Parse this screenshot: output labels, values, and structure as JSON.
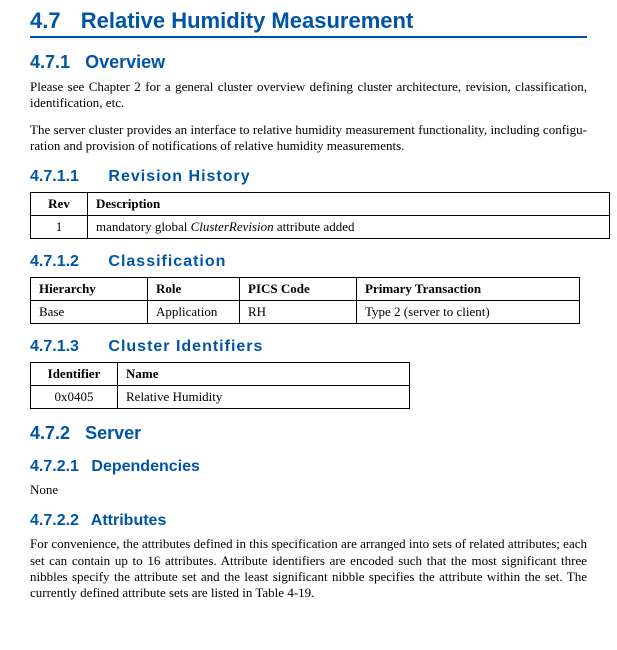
{
  "section": {
    "number": "4.7",
    "title": "Relative Humidity Measurement"
  },
  "overview": {
    "number": "4.7.1",
    "title": "Overview",
    "para1": "Please see Chapter 2 for a general cluster overview defining cluster architecture, revision, classification, identification, etc.",
    "para2": "The server cluster provides an interface to relative humidity measurement functionality, including configu­ration and provision of notifications of relative humidity measurements."
  },
  "revision_history": {
    "number": "4.7.1.1",
    "title": "Revision History",
    "headers": {
      "rev": "Rev",
      "desc": "Description"
    },
    "rows": [
      {
        "rev": "1",
        "desc_prefix": "mandatory global ",
        "desc_italic": "ClusterRevision",
        "desc_suffix": " attribute added"
      }
    ]
  },
  "classification": {
    "number": "4.7.1.2",
    "title": "Classification",
    "headers": {
      "hierarchy": "Hierarchy",
      "role": "Role",
      "pics": "PICS Code",
      "primary": "Primary Transaction"
    },
    "rows": [
      {
        "hierarchy": "Base",
        "role": "Application",
        "pics": "RH",
        "primary": "Type 2 (server to client)"
      }
    ]
  },
  "cluster_identifiers": {
    "number": "4.7.1.3",
    "title": "Cluster Identifiers",
    "headers": {
      "id": "Identifier",
      "name": "Name"
    },
    "rows": [
      {
        "id": "0x0405",
        "name": "Relative Humidity"
      }
    ]
  },
  "server": {
    "number": "4.7.2",
    "title": "Server"
  },
  "dependencies": {
    "number": "4.7.2.1",
    "title": "Dependencies",
    "text": "None"
  },
  "attributes": {
    "number": "4.7.2.2",
    "title": "Attributes",
    "para": "For convenience, the attributes defined in this specification are arranged into sets of related attributes; each set can contain up to 16 attributes. Attribute identifiers are encoded such that the most significant three nib­bles specify the attribute set and the least significant nibble specifies the attribute within the set. The currently defined attribute sets are listed in Table 4-19."
  }
}
